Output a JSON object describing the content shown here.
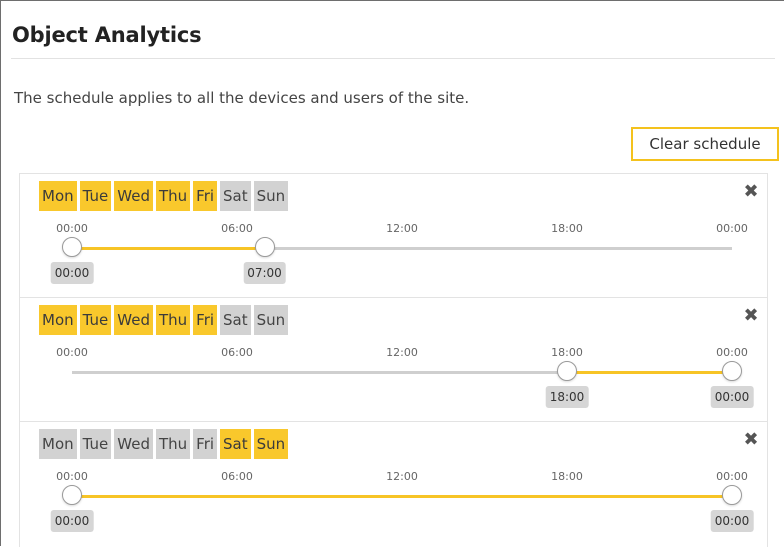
{
  "header": {
    "title": "Object Analytics",
    "description": "The schedule applies to all the devices and users of the site."
  },
  "toolbar": {
    "clear_label": "Clear schedule"
  },
  "colors": {
    "accent": "#f9c82c",
    "day_off": "#d2d2d2",
    "track": "#cfcfcf"
  },
  "timeline": {
    "ticks": [
      "00:00",
      "06:00",
      "12:00",
      "18:00",
      "00:00"
    ]
  },
  "schedules": [
    {
      "days": [
        {
          "label": "Mon",
          "active": true
        },
        {
          "label": "Tue",
          "active": true
        },
        {
          "label": "Wed",
          "active": true
        },
        {
          "label": "Thu",
          "active": true
        },
        {
          "label": "Fri",
          "active": true
        },
        {
          "label": "Sat",
          "active": false
        },
        {
          "label": "Sun",
          "active": false
        }
      ],
      "start": "00:00",
      "end": "07:00",
      "remove_icon": "close-icon"
    },
    {
      "days": [
        {
          "label": "Mon",
          "active": true
        },
        {
          "label": "Tue",
          "active": true
        },
        {
          "label": "Wed",
          "active": true
        },
        {
          "label": "Thu",
          "active": true
        },
        {
          "label": "Fri",
          "active": true
        },
        {
          "label": "Sat",
          "active": false
        },
        {
          "label": "Sun",
          "active": false
        }
      ],
      "start": "18:00",
      "end": "00:00",
      "remove_icon": "close-icon"
    },
    {
      "days": [
        {
          "label": "Mon",
          "active": false
        },
        {
          "label": "Tue",
          "active": false
        },
        {
          "label": "Wed",
          "active": false
        },
        {
          "label": "Thu",
          "active": false
        },
        {
          "label": "Fri",
          "active": false
        },
        {
          "label": "Sat",
          "active": true
        },
        {
          "label": "Sun",
          "active": true
        }
      ],
      "start": "00:00",
      "end": "00:00",
      "remove_icon": "close-icon"
    }
  ]
}
